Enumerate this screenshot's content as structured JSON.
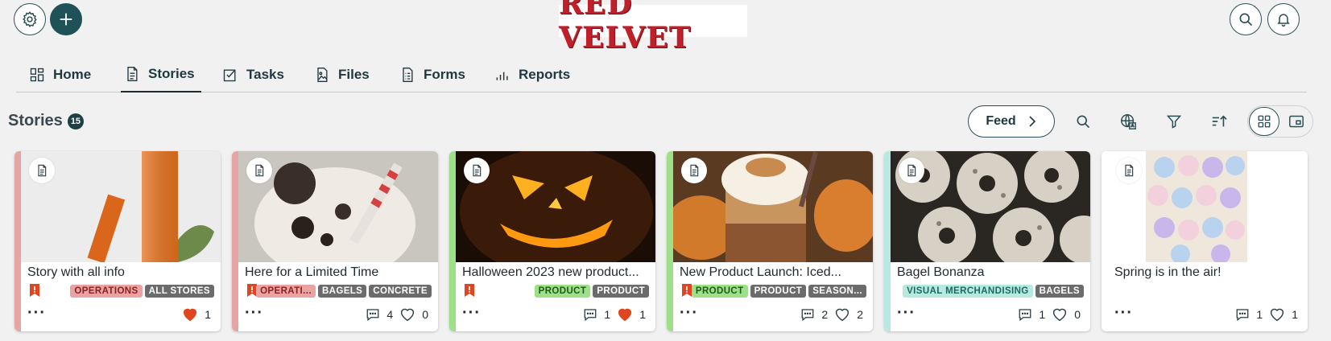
{
  "brand": {
    "name": "RED VELVET"
  },
  "header": {
    "settings_icon": "gear-icon",
    "add_icon": "plus-icon",
    "search_icon": "search-icon",
    "notifications_icon": "bell-icon"
  },
  "nav": {
    "tabs": [
      {
        "label": "Home",
        "icon": "grid-icon",
        "active": false
      },
      {
        "label": "Stories",
        "icon": "document-icon",
        "active": true
      },
      {
        "label": "Tasks",
        "icon": "checklist-icon",
        "active": false
      },
      {
        "label": "Files",
        "icon": "image-file-icon",
        "active": false
      },
      {
        "label": "Forms",
        "icon": "form-icon",
        "active": false
      },
      {
        "label": "Reports",
        "icon": "bar-chart-icon",
        "active": false
      }
    ]
  },
  "stories": {
    "title": "Stories",
    "count": "15",
    "feed_label": "Feed",
    "view_mode": "grid"
  },
  "colors": {
    "accent": "#1f5158",
    "operations_stripe": "#e7a4a4",
    "product_stripe": "#9ee08a",
    "vm_stripe": "#b6eae0",
    "like_red": "#e0451f"
  },
  "cards": [
    {
      "title": "Story with all info",
      "stripe": "#e7a4a4",
      "bookmarked": true,
      "tags": [
        {
          "label": "OPERATIONS",
          "style": "ops"
        },
        {
          "label": "ALL STORES",
          "style": "gray"
        }
      ],
      "comments": "",
      "likes": "1",
      "liked": true,
      "image": "skincare-tubes"
    },
    {
      "title": "Here for a Limited Time",
      "stripe": "#e7a4a4",
      "bookmarked": true,
      "tags": [
        {
          "label": "OPERATI...",
          "style": "ops"
        },
        {
          "label": "BAGELS",
          "style": "gray"
        },
        {
          "label": "CONCRETE",
          "style": "gray"
        }
      ],
      "comments": "4",
      "likes": "0",
      "liked": false,
      "image": "cookie-milkshake"
    },
    {
      "title": "Halloween 2023 new product...",
      "stripe": "#9ee08a",
      "bookmarked": true,
      "tags": [
        {
          "label": "PRODUCT",
          "style": "prod"
        },
        {
          "label": "PRODUCT",
          "style": "gray"
        }
      ],
      "comments": "1",
      "likes": "1",
      "liked": true,
      "image": "jack-o-lantern"
    },
    {
      "title": "New Product Launch: Iced...",
      "stripe": "#9ee08a",
      "bookmarked": true,
      "tags": [
        {
          "label": "PRODUCT",
          "style": "prod"
        },
        {
          "label": "PRODUCT",
          "style": "gray"
        },
        {
          "label": "SEASON...",
          "style": "gray"
        }
      ],
      "comments": "2",
      "likes": "2",
      "liked": false,
      "image": "iced-coffee"
    },
    {
      "title": "Bagel Bonanza",
      "stripe": "#b6eae0",
      "bookmarked": false,
      "tags": [
        {
          "label": "VISUAL MERCHANDISING",
          "style": "vm"
        },
        {
          "label": "BAGELS",
          "style": "gray"
        }
      ],
      "comments": "1",
      "likes": "0",
      "liked": false,
      "image": "bagels"
    },
    {
      "title": "Spring is in the air!",
      "stripe": "#ffffff",
      "bookmarked": false,
      "tags": [],
      "comments": "1",
      "likes": "1",
      "liked": false,
      "image": "cupcakes"
    }
  ]
}
